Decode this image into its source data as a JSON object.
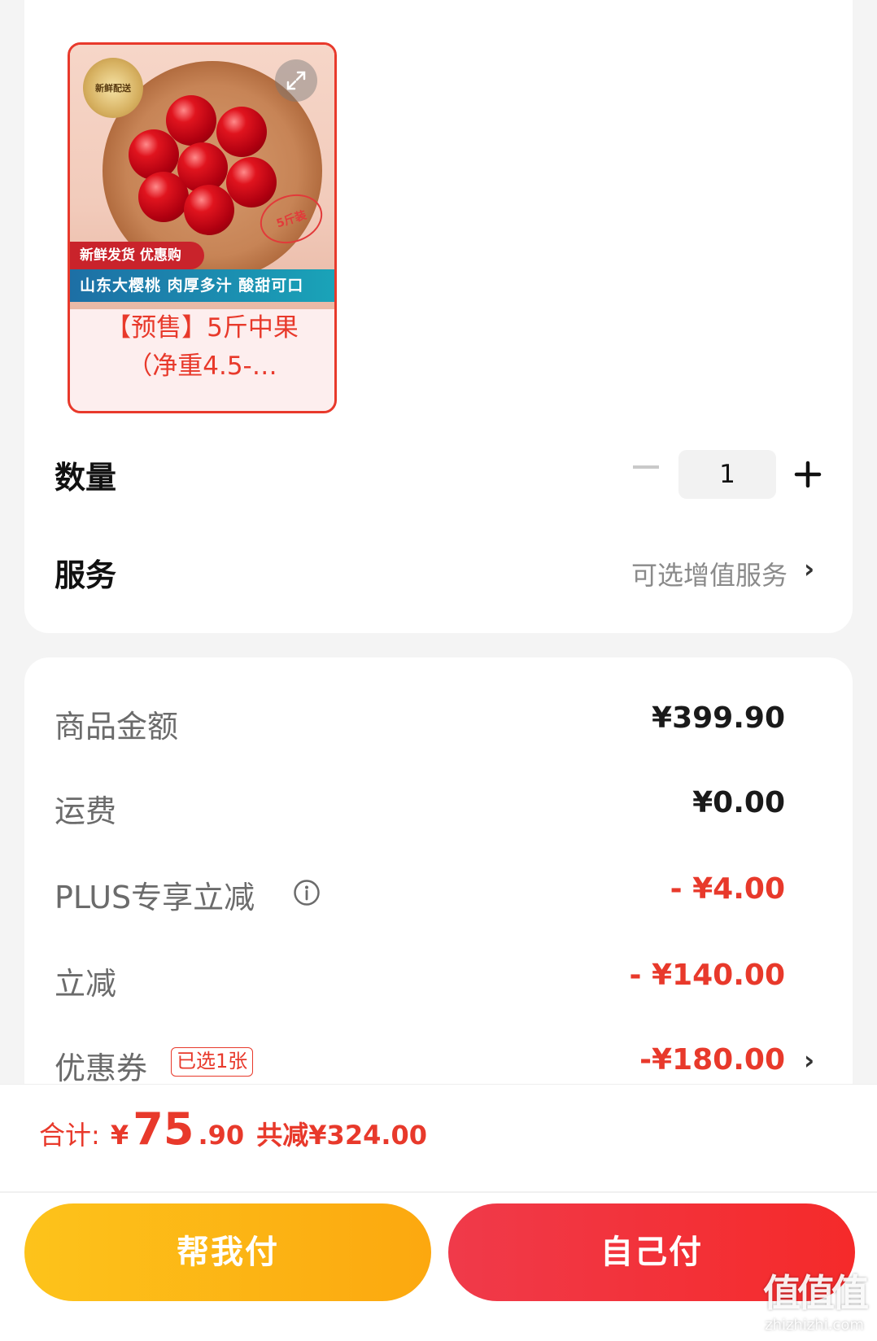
{
  "product": {
    "seal_text": "新鲜配送",
    "stamp_text": "5斤装",
    "promo_red": "新鲜发货 优惠购",
    "promo_teal": "山东大樱桃 肉厚多汁 酸甜可口",
    "title": "【预售】5斤中果（净重4.5-…"
  },
  "quantity": {
    "label": "数量",
    "value": "1"
  },
  "service": {
    "label": "服务",
    "text": "可选增值服务"
  },
  "fees": {
    "goods_label": "商品金额",
    "goods_value": "¥399.90",
    "shipping_label": "运费",
    "shipping_value": "¥0.00",
    "plus_label": "PLUS专享立减",
    "plus_value": "- ¥4.00",
    "instant_label": "立减",
    "instant_value": "- ¥140.00",
    "coupon_label": "优惠券",
    "coupon_badge": "已选1张",
    "coupon_value": "-¥180.00"
  },
  "total": {
    "label": "合计:",
    "yen": "¥",
    "amount_int": "75",
    "amount_dec": ".90",
    "saved": "共减¥324.00"
  },
  "buttons": {
    "help_pay": "帮我付",
    "self_pay": "自己付"
  },
  "watermark": {
    "main": "值值值",
    "sub": "zhizhizhi.com"
  },
  "colors": {
    "accent_red": "#e8392b",
    "help_pay_yellow": "#fdb716",
    "self_pay_red": "#f2333f"
  }
}
